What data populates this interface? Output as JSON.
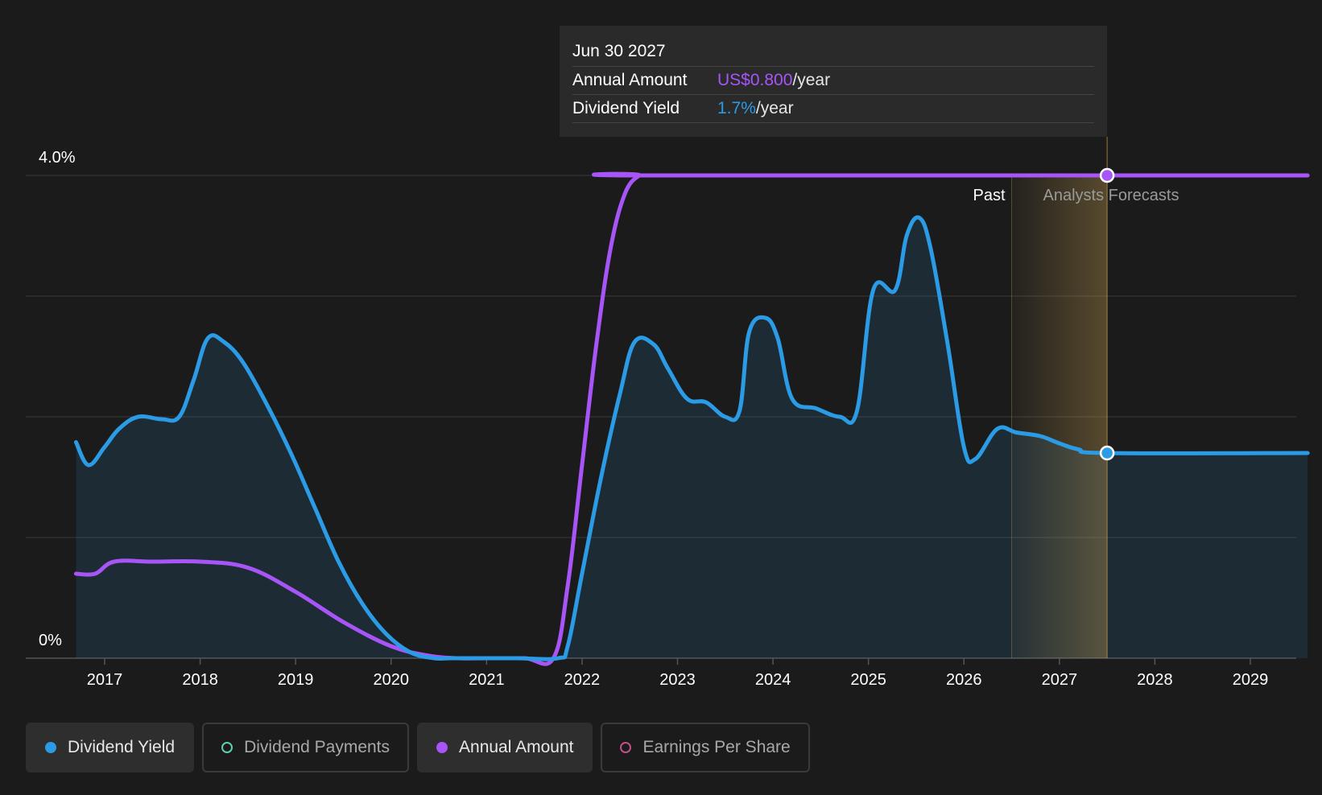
{
  "tooltip": {
    "date": "Jun 30 2027",
    "annual_label": "Annual Amount",
    "annual_value": "US$0.800",
    "annual_unit": "/year",
    "yield_label": "Dividend Yield",
    "yield_value": "1.7%",
    "yield_unit": "/year"
  },
  "legend": [
    {
      "label": "Dividend Yield",
      "active": true,
      "color": "#2b9be6"
    },
    {
      "label": "Dividend Payments",
      "active": false,
      "color": "#5ecfb1"
    },
    {
      "label": "Annual Amount",
      "active": true,
      "color": "#a855f7"
    },
    {
      "label": "Earnings Per Share",
      "active": false,
      "color": "#c0508a"
    }
  ],
  "chart_data": {
    "type": "line",
    "y_tick_labels": {
      "top": "4.0%",
      "bottom": "0%"
    },
    "ylim": [
      0,
      4.0
    ],
    "xlim": [
      2016.4,
      2029.6
    ],
    "x_ticks": [
      2017,
      2018,
      2019,
      2020,
      2021,
      2022,
      2023,
      2024,
      2025,
      2026,
      2027,
      2028,
      2029
    ],
    "grid": true,
    "past_label": "Past",
    "forecast_label": "Analysts Forecasts",
    "forecast_start": 2026.5,
    "hover_x": 2027.5,
    "colors": {
      "yield": "#2b9be6",
      "annual": "#a855f7",
      "forecast": "#c8a050"
    },
    "series": [
      {
        "name": "Dividend Yield",
        "x": [
          2016.7,
          2016.83,
          2017.0,
          2017.15,
          2017.35,
          2017.6,
          2017.78,
          2017.93,
          2018.08,
          2018.25,
          2018.45,
          2018.7,
          2018.95,
          2019.2,
          2019.45,
          2019.7,
          2019.95,
          2020.2,
          2020.45,
          2020.62,
          2020.8,
          2021.3,
          2021.75,
          2021.85,
          2022.0,
          2022.2,
          2022.4,
          2022.55,
          2022.75,
          2022.9,
          2023.1,
          2023.3,
          2023.5,
          2023.65,
          2023.75,
          2023.92,
          2024.05,
          2024.2,
          2024.45,
          2024.7,
          2024.88,
          2025.05,
          2025.28,
          2025.4,
          2025.53,
          2025.65,
          2025.83,
          2026.0,
          2026.12,
          2026.35,
          2026.55,
          2026.8,
          2027.0,
          2027.2,
          2027.5,
          2029.6
        ],
        "y": [
          1.79,
          1.6,
          1.75,
          1.9,
          2.0,
          1.98,
          2.0,
          2.3,
          2.65,
          2.62,
          2.45,
          2.1,
          1.7,
          1.25,
          0.8,
          0.45,
          0.2,
          0.05,
          0.0,
          0.0,
          0.0,
          0.0,
          0.0,
          0.1,
          0.7,
          1.5,
          2.2,
          2.62,
          2.6,
          2.4,
          2.15,
          2.12,
          2.0,
          2.05,
          2.7,
          2.82,
          2.65,
          2.15,
          2.07,
          2.0,
          2.05,
          3.05,
          3.05,
          3.5,
          3.65,
          3.4,
          2.6,
          1.75,
          1.65,
          1.9,
          1.87,
          1.84,
          1.78,
          1.73,
          1.7,
          1.7
        ]
      },
      {
        "name": "Annual Amount",
        "x": [
          2016.7,
          2016.9,
          2017.1,
          2017.5,
          2018.0,
          2018.5,
          2019.0,
          2019.5,
          2020.0,
          2020.4,
          2020.7,
          2021.0,
          2021.4,
          2021.7,
          2021.85,
          2022.0,
          2022.15,
          2022.3,
          2022.45,
          2022.6,
          2022.7,
          2029.6
        ],
        "y": [
          0.7,
          0.7,
          0.8,
          0.8,
          0.8,
          0.75,
          0.55,
          0.3,
          0.1,
          0.02,
          0.0,
          0.0,
          0.0,
          0.0,
          0.6,
          1.6,
          2.6,
          3.4,
          3.85,
          4.0,
          4.0,
          4.0
        ]
      }
    ]
  }
}
